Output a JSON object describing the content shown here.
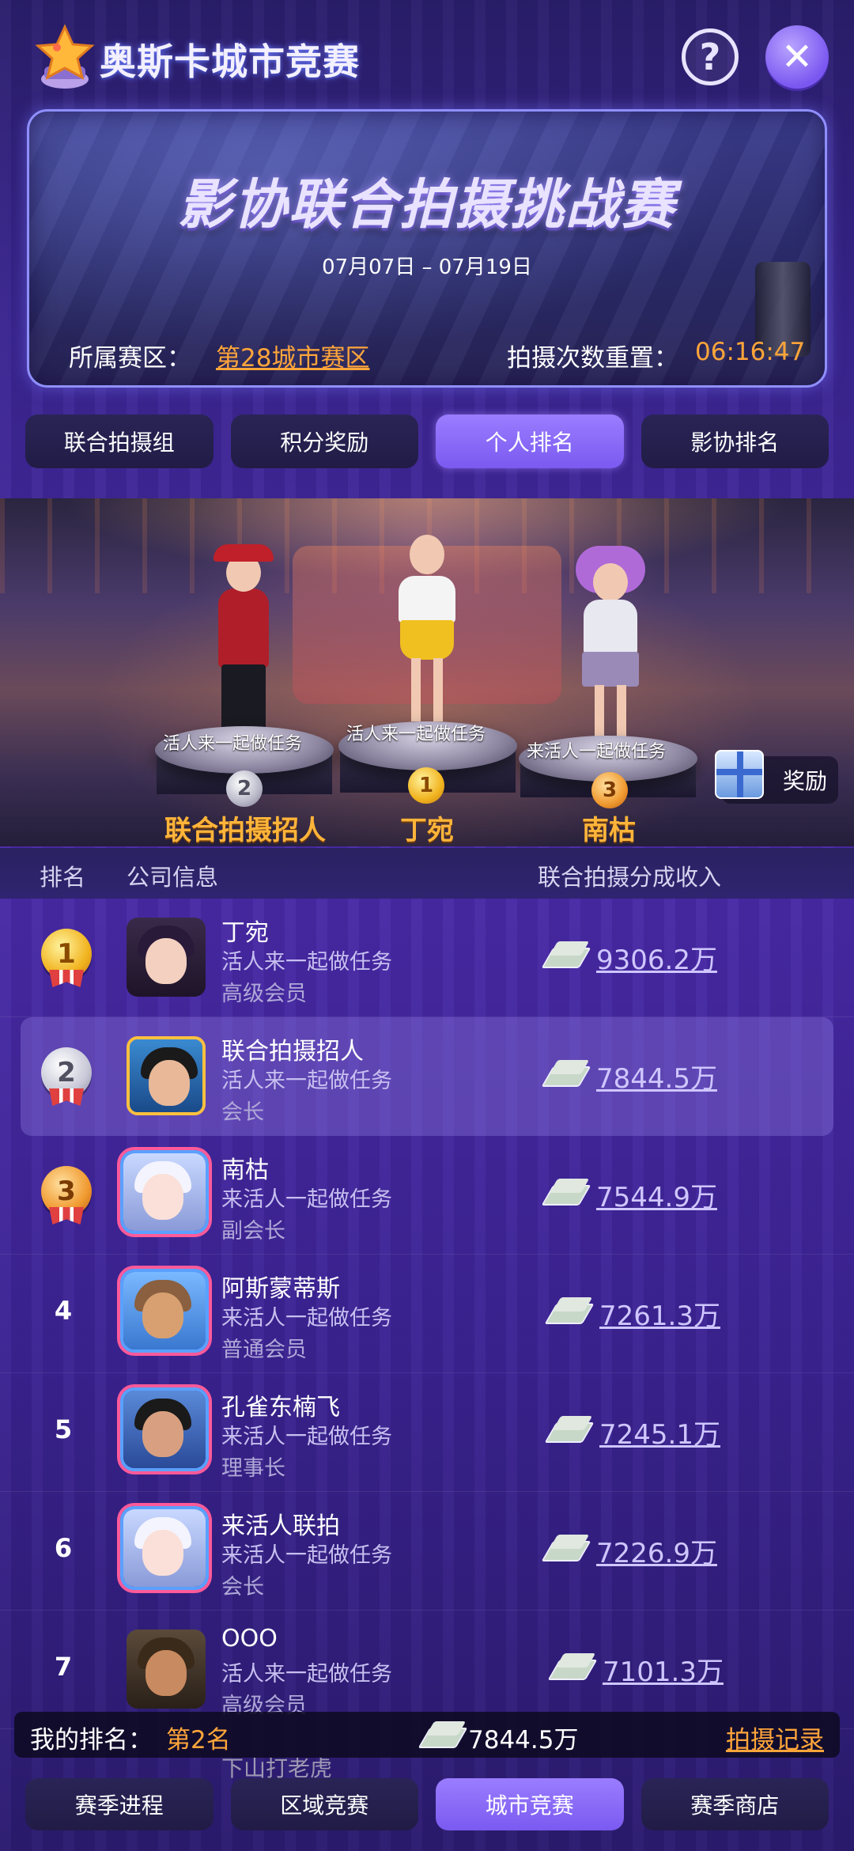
{
  "header": {
    "title": "奥斯卡城市竞赛",
    "help_icon": "question-circle-icon",
    "close_icon": "close-x-icon"
  },
  "banner": {
    "title": "影协联合拍摄挑战赛",
    "date_range": "07月07日 – 07月19日",
    "zone_label": "所属赛区：",
    "zone_value": "第28城市赛区",
    "reset_label": "拍摄次数重置：",
    "reset_value": "06:16:47"
  },
  "tabs": [
    {
      "label": "联合拍摄组",
      "active": false
    },
    {
      "label": "积分奖励",
      "active": false
    },
    {
      "label": "个人排名",
      "active": true
    },
    {
      "label": "影协排名",
      "active": false
    }
  ],
  "podium": {
    "first": {
      "name": "丁宛",
      "motto": "活人来一起做任务",
      "medal": "1"
    },
    "second": {
      "name": "联合拍摄招人",
      "motto": "活人来一起做任务",
      "medal": "2"
    },
    "third": {
      "name": "南枯",
      "motto": "来活人一起做任务",
      "medal": "3"
    },
    "reward_label": "奖励"
  },
  "table": {
    "col_rank": "排名",
    "col_company": "公司信息",
    "col_income": "联合拍摄分成收入",
    "rows": [
      {
        "rank": "1",
        "name": "丁宛",
        "company": "活人来一起做任务",
        "role": "高级会员",
        "income": "9306.2万"
      },
      {
        "rank": "2",
        "name": "联合拍摄招人",
        "company": "活人来一起做任务",
        "role": "会长",
        "income": "7844.5万"
      },
      {
        "rank": "3",
        "name": "南枯",
        "company": "来活人一起做任务",
        "role": "副会长",
        "income": "7544.9万"
      },
      {
        "rank": "4",
        "name": "阿斯蒙蒂斯",
        "company": "来活人一起做任务",
        "role": "普通会员",
        "income": "7261.3万"
      },
      {
        "rank": "5",
        "name": "孔雀东楠飞",
        "company": "来活人一起做任务",
        "role": "理事长",
        "income": "7245.1万"
      },
      {
        "rank": "6",
        "name": "来活人联拍",
        "company": "来活人一起做任务",
        "role": "会长",
        "income": "7226.9万"
      },
      {
        "rank": "7",
        "name": "OOO",
        "company": "活人来一起做任务",
        "role": "高级会员",
        "income": "7101.3万"
      }
    ],
    "peek_name": "下山打老虎"
  },
  "my_rank": {
    "label": "我的排名：",
    "rank": "第2名",
    "income": "7844.5万",
    "record_label": "拍摄记录"
  },
  "bottom_nav": [
    {
      "label": "赛季进程",
      "active": false
    },
    {
      "label": "区域竞赛",
      "active": false
    },
    {
      "label": "城市竞赛",
      "active": true
    },
    {
      "label": "赛季商店",
      "active": false
    }
  ],
  "colors": {
    "accent_orange": "#ffa53a",
    "active_tab": "#8a6cf8",
    "background": "#3d2496"
  }
}
